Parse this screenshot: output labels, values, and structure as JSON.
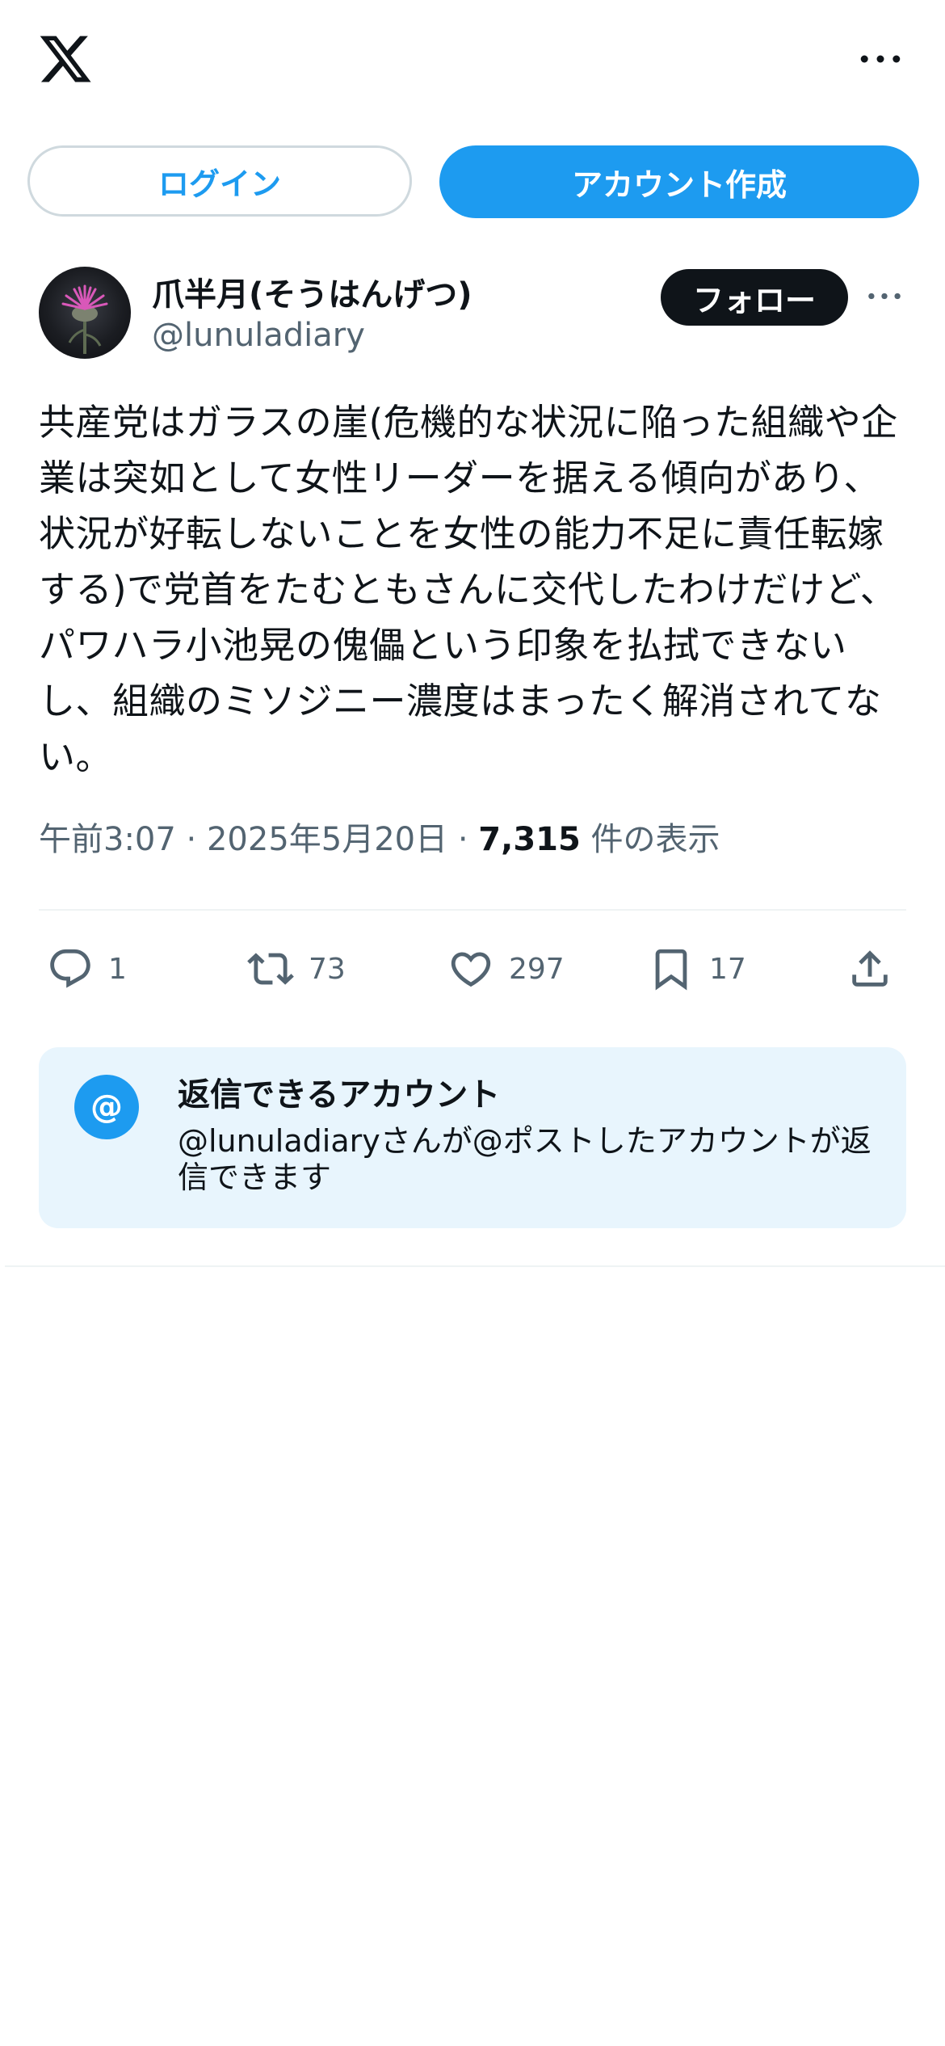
{
  "header": {
    "logo_icon": "x-logo-icon",
    "more_icon": "more-horizontal-icon"
  },
  "auth": {
    "login_label": "ログイン",
    "signup_label": "アカウント作成"
  },
  "tweet": {
    "display_name": "爪半月(そうはんげつ)",
    "handle": "@lunuladiary",
    "follow_label": "フォロー",
    "text": "共産党はガラスの崖(危機的な状況に陥った組織や企業は突如として女性リーダーを据える傾向があり、状況が好転しないことを女性の能力不足に責任転嫁する)で党首をたむともさんに交代したわけだけど、パワハラ小池晃の傀儡という印象を払拭できないし、組織のミソジニー濃度はまったく解消されてない。",
    "time": "午前3:07",
    "date": "2025年5月20日",
    "separator": "·",
    "views_count": "7,315",
    "views_label": "件の表示",
    "stats": {
      "replies": "1",
      "reposts": "73",
      "likes": "297",
      "bookmarks": "17"
    }
  },
  "reply_settings": {
    "title": "返信できるアカウント",
    "description": "@lunuladiaryさんが@ポストしたアカウントが返信できます",
    "icon": "@"
  },
  "colors": {
    "accent": "#1d9bf0",
    "text": "#0f1419",
    "muted": "#536471",
    "reply_bg": "#e8f5fd",
    "border": "#cfd9de"
  }
}
